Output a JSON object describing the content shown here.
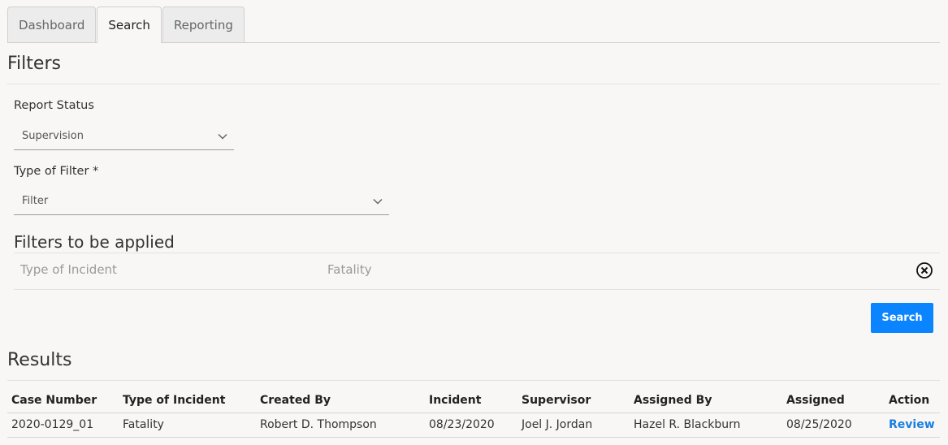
{
  "tabs": [
    {
      "label": "Dashboard",
      "active": false
    },
    {
      "label": "Search",
      "active": true
    },
    {
      "label": "Reporting",
      "active": false
    }
  ],
  "filters": {
    "title": "Filters",
    "report_status": {
      "label": "Report Status",
      "value": "Supervision"
    },
    "filter_type": {
      "label": "Type of Filter *",
      "value": "Filter"
    },
    "applied": {
      "title": "Filters to be applied",
      "items": [
        {
          "key": "Type of Incident",
          "value": "Fatality"
        }
      ]
    },
    "search_label": "Search"
  },
  "results": {
    "title": "Results",
    "columns": [
      "Case Number",
      "Type of Incident",
      "Created By",
      "Incident",
      "Supervisor",
      "Assigned By",
      "Assigned",
      "Action"
    ],
    "rows": [
      {
        "case_number": "2020-0129_01",
        "type_of_incident": "Fatality",
        "created_by": "Robert D. Thompson",
        "incident": "08/23/2020",
        "supervisor": "Joel J. Jordan",
        "assigned_by": "Hazel R. Blackburn",
        "assigned": "08/25/2020",
        "action": "Review"
      }
    ]
  },
  "colors": {
    "accent": "#0a84ff",
    "link": "#1a7fe0",
    "background": "#f9f7f5"
  }
}
